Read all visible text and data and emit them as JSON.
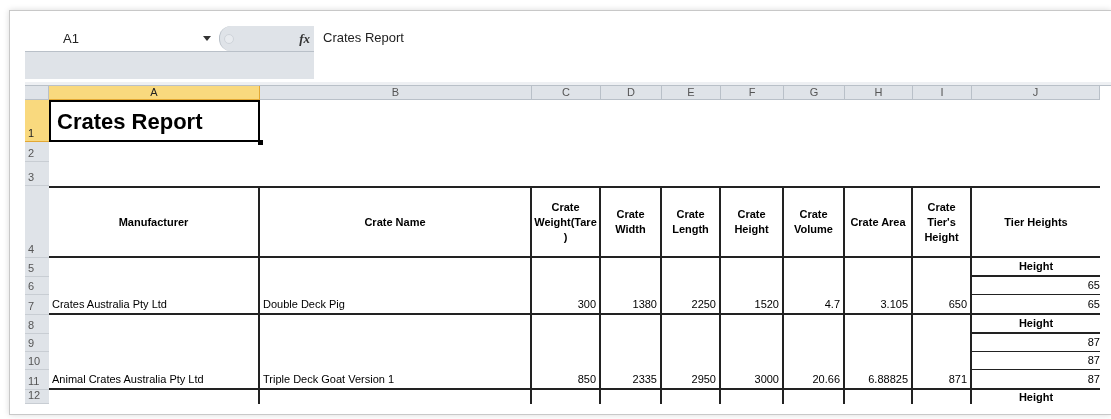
{
  "formula_bar": {
    "name_box": "A1",
    "function_label": "fx",
    "formula": "Crates Report"
  },
  "columns": [
    {
      "label": "A",
      "selected": true
    },
    {
      "label": "B",
      "selected": false
    },
    {
      "label": "C",
      "selected": false
    },
    {
      "label": "D",
      "selected": false
    },
    {
      "label": "E",
      "selected": false
    },
    {
      "label": "F",
      "selected": false
    },
    {
      "label": "G",
      "selected": false
    },
    {
      "label": "H",
      "selected": false
    },
    {
      "label": "I",
      "selected": false
    },
    {
      "label": "J",
      "selected": false
    }
  ],
  "rows": [
    {
      "label": "1",
      "selected": true
    },
    {
      "label": "2",
      "selected": false
    },
    {
      "label": "3",
      "selected": false
    },
    {
      "label": "4",
      "selected": false
    },
    {
      "label": "5",
      "selected": false
    },
    {
      "label": "6",
      "selected": false
    },
    {
      "label": "7",
      "selected": false
    },
    {
      "label": "8",
      "selected": false
    },
    {
      "label": "9",
      "selected": false
    },
    {
      "label": "10",
      "selected": false
    },
    {
      "label": "11",
      "selected": false
    },
    {
      "label": "12",
      "selected": false
    }
  ],
  "title": "Crates Report",
  "table": {
    "header": [
      "Manufacturer",
      "Crate Name",
      "Crate Weight(Tare)",
      "Crate Width",
      "Crate Length",
      "Crate Height",
      "Crate Volume",
      "Crate Area",
      "Crate Tier's Height",
      "Tier Heights"
    ],
    "records": [
      {
        "manufacturer": "Crates Australia Pty Ltd",
        "crate_name": "Double Deck Pig",
        "values": [
          "300",
          "1380",
          "2250",
          "1520",
          "4.7",
          "3.105",
          "650"
        ],
        "tier_heights": {
          "label": "Height",
          "values": [
            "65",
            "65"
          ]
        }
      },
      {
        "manufacturer": "Animal Crates Australia Pty Ltd",
        "crate_name": "Triple Deck Goat Version 1",
        "values": [
          "850",
          "2335",
          "2950",
          "3000",
          "20.66",
          "6.88825",
          "871"
        ],
        "tier_heights": {
          "label": "Height",
          "values": [
            "87",
            "87",
            "87"
          ]
        }
      },
      {
        "tier_heights": {
          "label": "Height"
        }
      }
    ]
  }
}
